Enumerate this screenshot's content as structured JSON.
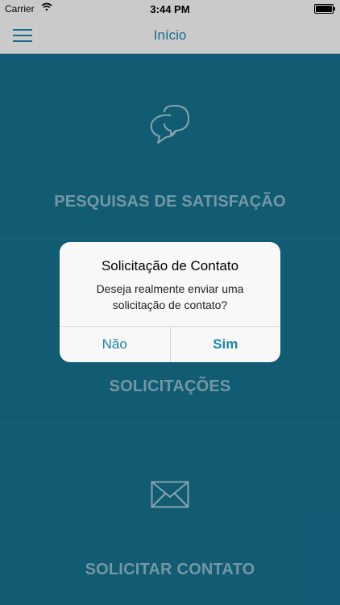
{
  "status_bar": {
    "carrier": "Carrier",
    "time": "3:44 PM"
  },
  "nav": {
    "title": "Início"
  },
  "sections": [
    {
      "label": "PESQUISAS DE SATISFAÇÃO",
      "icon": "chat-bubbles-icon"
    },
    {
      "label": "SOLICITAÇÕES",
      "icon": "list-icon"
    },
    {
      "label": "SOLICITAR CONTATO",
      "icon": "envelope-icon"
    }
  ],
  "alert": {
    "title": "Solicitação de Contato",
    "message": "Deseja realmente enviar uma solicitação de contato?",
    "cancel_label": "Não",
    "confirm_label": "Sim"
  },
  "colors": {
    "accent": "#1d86a9",
    "background": "#156f8d",
    "section_text": "#8fb7c8"
  }
}
